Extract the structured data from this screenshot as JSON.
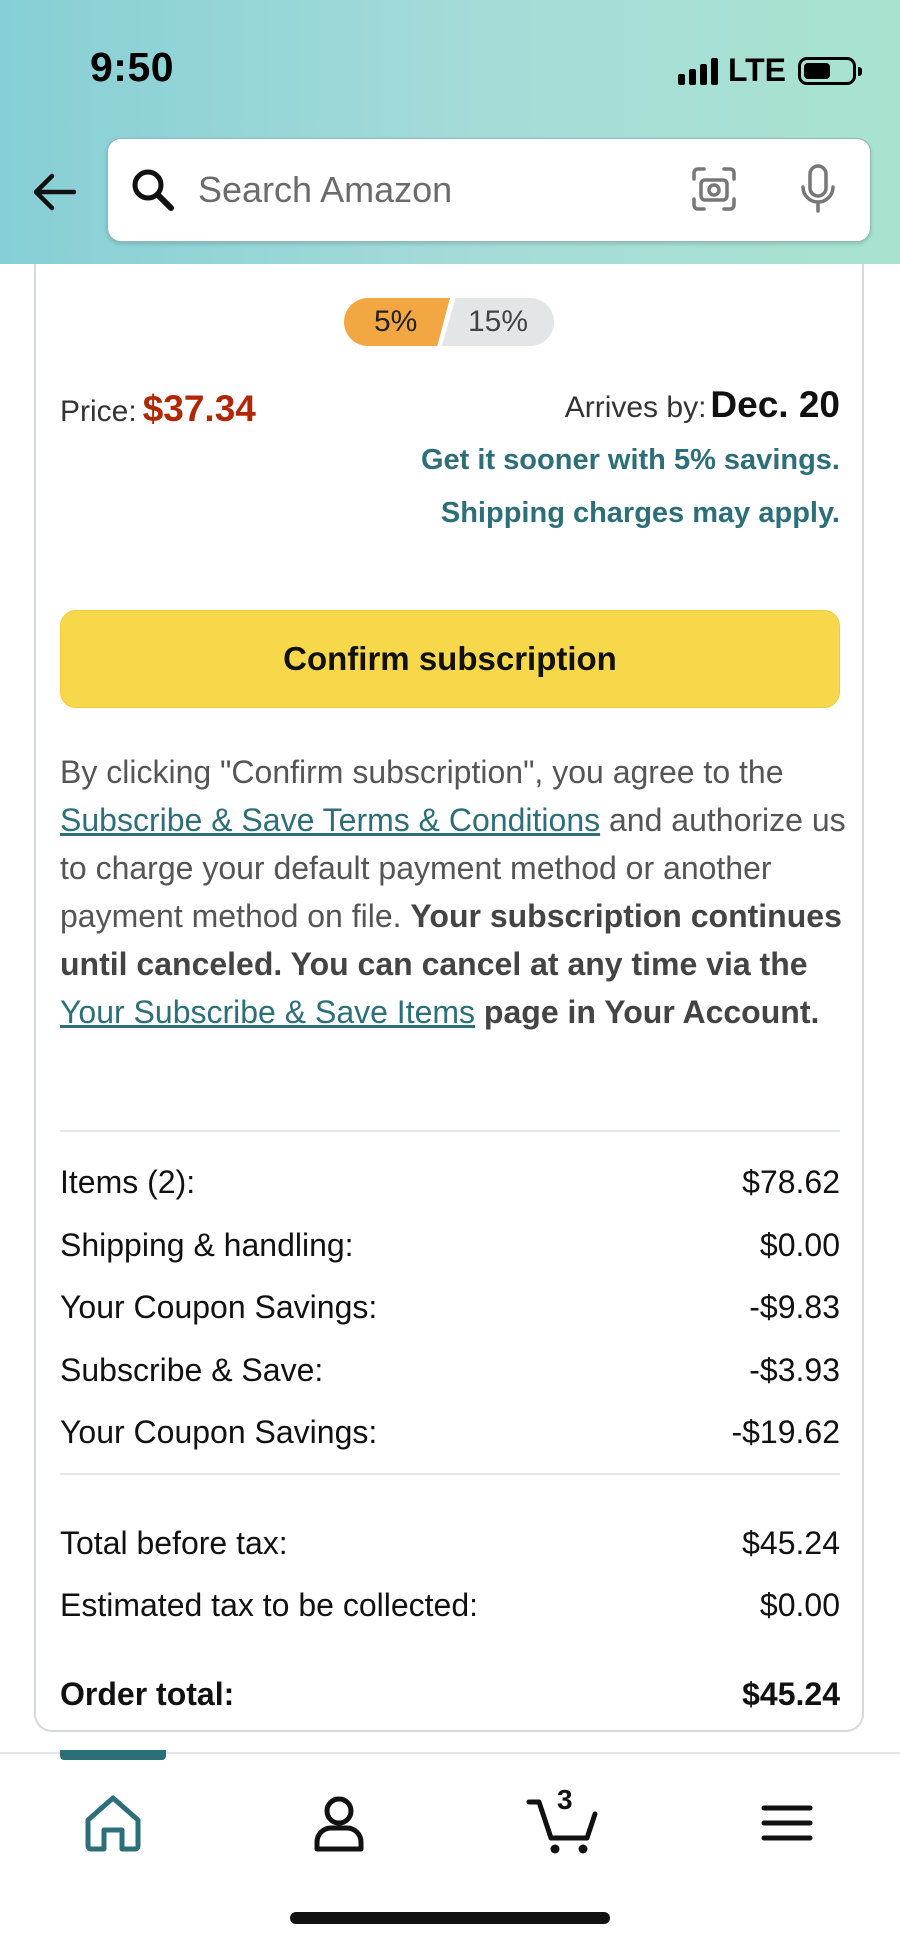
{
  "status_bar": {
    "time": "9:50",
    "network": "LTE"
  },
  "search": {
    "placeholder": "Search Amazon"
  },
  "discount_tiers": {
    "selected": "5%",
    "other": "15%"
  },
  "price": {
    "label": "Price:",
    "value": "$37.34"
  },
  "arrival": {
    "label": "Arrives by:",
    "date": "Dec. 20",
    "sooner_note": "Get it sooner with 5% savings. Shipping charges may apply."
  },
  "confirm_button": {
    "label": "Confirm subscription"
  },
  "legal": {
    "part1": "By clicking \"Confirm subscription\", you agree to the ",
    "terms_link": "Subscribe & Save Terms & Conditions",
    "part2": " and authorize us to charge your default payment method or another payment method on file. ",
    "bold1": "Your subscription continues until canceled. You can cancel at any time via the ",
    "items_link": "Your Subscribe & Save Items",
    "bold2": " page in Your Account."
  },
  "summary": {
    "rows": [
      {
        "label": "Items (2):",
        "value": "$78.62"
      },
      {
        "label": "Shipping & handling:",
        "value": "$0.00"
      },
      {
        "label": "Your Coupon Savings:",
        "value": "-$9.83"
      },
      {
        "label": "Subscribe & Save:",
        "value": "-$3.93"
      },
      {
        "label": "Your Coupon Savings:",
        "value": "-$19.62"
      }
    ],
    "total_before_tax": {
      "label": "Total before tax:",
      "value": "$45.24"
    },
    "tax": {
      "label": "Estimated tax to be collected:",
      "value": "$0.00"
    },
    "order_total": {
      "label": "Order total:",
      "value": "$45.24"
    }
  },
  "bottom_nav": {
    "items": [
      "home-icon",
      "account-icon",
      "cart-icon",
      "menu-icon"
    ],
    "cart_count": "3",
    "active_color": "#2d6f79"
  },
  "colors": {
    "price": "#b12704",
    "link": "#2d6f79",
    "button": "#f7d84a"
  }
}
